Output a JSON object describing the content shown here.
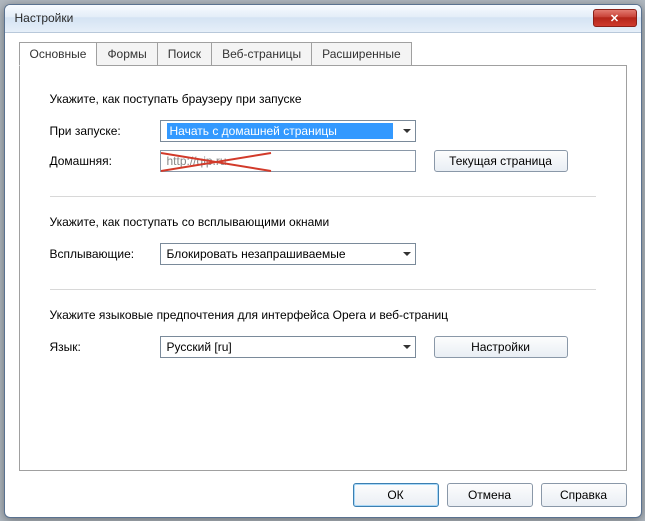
{
  "window": {
    "title": "Настройки",
    "close_glyph": "✕"
  },
  "tabs": {
    "general": "Основные",
    "forms": "Формы",
    "search": "Поиск",
    "webpages": "Веб-страницы",
    "advanced": "Расширенные"
  },
  "startup": {
    "section_label": "Укажите, как поступать браузеру при запуске",
    "on_start_label": "При запуске:",
    "on_start_value": "Начать с домашней страницы",
    "home_label": "Домашняя:",
    "home_value": "http://qip.ru",
    "current_page_btn": "Текущая страница"
  },
  "popups": {
    "section_label": "Укажите, как поступать со всплывающими окнами",
    "label": "Всплывающие:",
    "value": "Блокировать незапрашиваемые"
  },
  "language": {
    "section_label": "Укажите языковые предпочтения для интерфейса Opera и веб-страниц",
    "label": "Язык:",
    "value": "Русский [ru]",
    "settings_btn": "Настройки"
  },
  "buttons": {
    "ok": "ОК",
    "cancel": "Отмена",
    "help": "Справка"
  }
}
